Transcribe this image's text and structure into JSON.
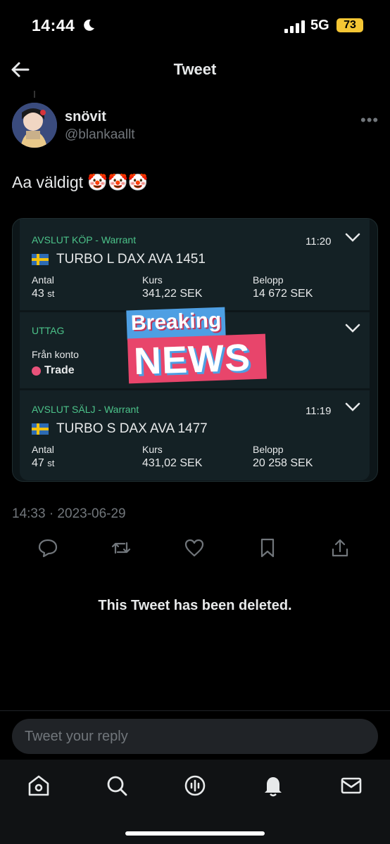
{
  "status_bar": {
    "time": "14:44",
    "network": "5G",
    "battery": "73"
  },
  "header": {
    "title": "Tweet"
  },
  "author": {
    "name": "snövit",
    "handle": "@blankaallt"
  },
  "tweet": {
    "text": "Aa väldigt 🤡🤡🤡",
    "timestamp": "14:33 · 2023-06-29"
  },
  "card": {
    "rows": [
      {
        "label": "AVSLUT KÖP - Warrant",
        "time": "11:20",
        "instrument": "TURBO L DAX AVA 1451",
        "antal_label": "Antal",
        "antal": "43",
        "antal_unit": "st",
        "kurs_label": "Kurs",
        "kurs": "341,22 SEK",
        "belopp_label": "Belopp",
        "belopp": "14 672 SEK"
      },
      {
        "label": "UTTAG",
        "from_label": "Från konto",
        "account": "Trade"
      },
      {
        "label": "AVSLUT SÄLJ - Warrant",
        "time": "11:19",
        "instrument": "TURBO S DAX AVA 1477",
        "antal_label": "Antal",
        "antal": "47",
        "antal_unit": "st",
        "kurs_label": "Kurs",
        "kurs": "431,02 SEK",
        "belopp_label": "Belopp",
        "belopp": "20 258 SEK"
      }
    ],
    "sticker": {
      "line1": "Breaking",
      "line2": "NEWS"
    }
  },
  "actions": [
    "reply-icon",
    "retweet-icon",
    "like-icon",
    "bookmark-icon",
    "share-icon"
  ],
  "deleted_notice": "This Tweet has been deleted.",
  "reply": {
    "placeholder": "Tweet your reply"
  },
  "tabs": [
    "home-icon",
    "search-icon",
    "spaces-icon",
    "notifications-icon",
    "messages-icon"
  ],
  "colors": {
    "accent_green": "#4cc38a",
    "badge_yellow": "#f5c634",
    "trade_dot": "#e8527a"
  }
}
